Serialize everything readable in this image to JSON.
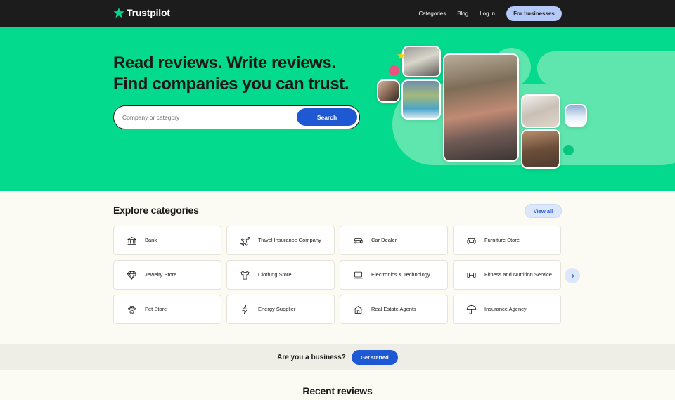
{
  "header": {
    "brand": "Trustpilot",
    "nav": [
      "Categories",
      "Blog",
      "Log in"
    ],
    "cta": "For businesses"
  },
  "hero": {
    "headline_line1": "Read reviews. Write reviews.",
    "headline_line2": "Find companies you can trust.",
    "search_placeholder": "Company or category",
    "search_button": "Search"
  },
  "categories": {
    "heading": "Explore categories",
    "view_all": "View all",
    "items": [
      {
        "label": "Bank",
        "icon": "bank-icon"
      },
      {
        "label": "Travel Insurance Company",
        "icon": "airplane-icon"
      },
      {
        "label": "Car Dealer",
        "icon": "car-icon"
      },
      {
        "label": "Furniture Store",
        "icon": "sofa-icon"
      },
      {
        "label": "Jewelry Store",
        "icon": "diamond-icon"
      },
      {
        "label": "Clothing Store",
        "icon": "shirt-icon"
      },
      {
        "label": "Electronics & Technology",
        "icon": "laptop-icon"
      },
      {
        "label": "Fitness and Nutrition Service",
        "icon": "dumbbell-icon"
      },
      {
        "label": "Pet Store",
        "icon": "paw-icon"
      },
      {
        "label": "Energy Supplier",
        "icon": "lightning-icon"
      },
      {
        "label": "Real Estate Agents",
        "icon": "house-icon"
      },
      {
        "label": "Insurance Agency",
        "icon": "umbrella-icon"
      }
    ]
  },
  "business": {
    "question": "Are you a business?",
    "button": "Get started"
  },
  "recent": {
    "heading": "Recent reviews"
  },
  "colors": {
    "header_bg": "#1c1c1c",
    "hero_bg": "#04da8d",
    "brand_star": "#04da8d",
    "primary_blue": "#1f58d3",
    "page_bg": "#fcfbf3"
  }
}
